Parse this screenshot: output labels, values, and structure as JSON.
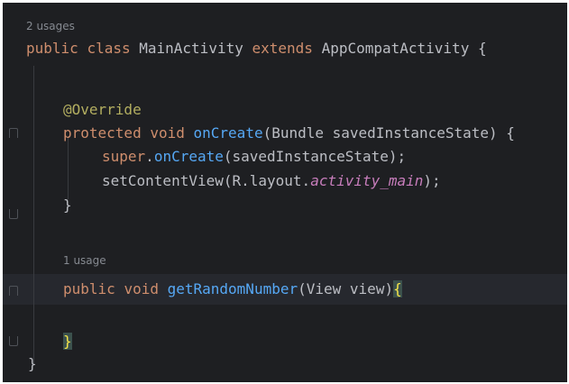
{
  "editor": {
    "hints": {
      "class_usages": "2 usages",
      "method_usages": "1 usage"
    },
    "lines": {
      "l1": {
        "kw1": "public",
        "kw2": "class",
        "name": "MainActivity",
        "kw3": "extends",
        "parent": "AppCompatActivity",
        "brace": " {"
      },
      "l2": {
        "annotation": "@Override"
      },
      "l3": {
        "kw1": "protected",
        "kw2": "void",
        "fn": "onCreate",
        "params": "(Bundle savedInstanceState) {"
      },
      "l4": {
        "kw": "super",
        "dot": ".",
        "fn": "onCreate",
        "args": "(savedInstanceState);"
      },
      "l5": {
        "pre": "setContentView(R.layout.",
        "field": "activity_main",
        "post": ");"
      },
      "l6": {
        "brace": "}"
      },
      "l7": {
        "kw1": "public",
        "kw2": "void",
        "fn": "getRandomNumber",
        "params": "(View view)",
        "brace": "{"
      },
      "l8": {
        "brace": "}"
      },
      "l9": {
        "brace": "}"
      }
    },
    "colors": {
      "background": "#1e1f22",
      "keyword": "#cf8e6d",
      "function": "#56a8f5",
      "annotation": "#b3ae60",
      "field": "#c77dbb",
      "matched_brace": "#f5e44a"
    }
  }
}
